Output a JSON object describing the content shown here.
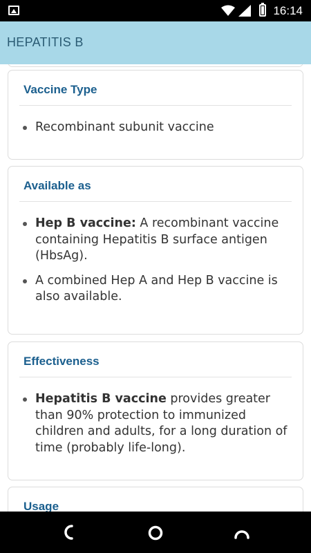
{
  "status_bar": {
    "time": "16:14",
    "icons": [
      "image-icon",
      "wifi-icon",
      "signal-icon",
      "battery-icon"
    ]
  },
  "app_bar": {
    "title": "HEPATITIS B",
    "background": "#a8d8e8"
  },
  "cards": [
    {
      "title": "Vaccine Type",
      "items": [
        {
          "bold": "",
          "text": "Recombinant subunit vaccine"
        }
      ]
    },
    {
      "title": "Available as",
      "items": [
        {
          "bold": "Hep B vaccine:",
          "text": " A recombinant vaccine containing Hepatitis B surface antigen (HbsAg)."
        },
        {
          "bold": "",
          "text": "A combined Hep A and Hep B vaccine is also available."
        }
      ]
    },
    {
      "title": "Effectiveness",
      "items": [
        {
          "bold": "Hepatitis B vaccine",
          "text": " provides greater than 90% protection to immunized children and adults, for a long duration of time (probably life-long)."
        }
      ]
    },
    {
      "title": "Usage",
      "items": []
    }
  ],
  "nav_bar": {
    "buttons": [
      "back-icon",
      "home-icon",
      "recents-icon"
    ]
  },
  "colors": {
    "accent": "#1b5f8e",
    "card_border": "#dcdcdc"
  }
}
